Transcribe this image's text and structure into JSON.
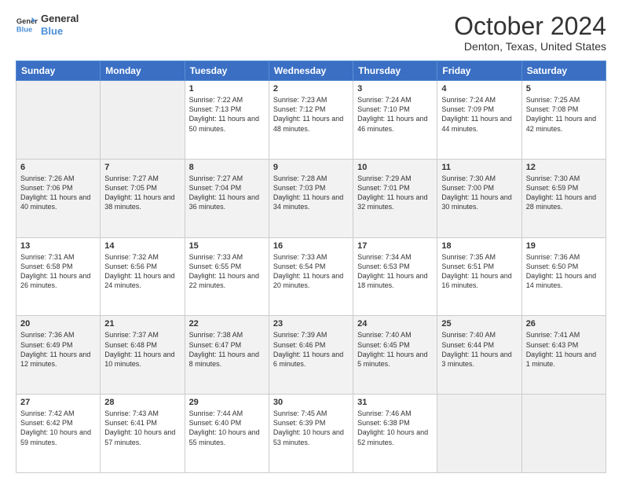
{
  "logo": {
    "line1": "General",
    "line2": "Blue"
  },
  "title": "October 2024",
  "location": "Denton, Texas, United States",
  "days_of_week": [
    "Sunday",
    "Monday",
    "Tuesday",
    "Wednesday",
    "Thursday",
    "Friday",
    "Saturday"
  ],
  "weeks": [
    [
      {
        "day": "",
        "sunrise": "",
        "sunset": "",
        "daylight": "",
        "empty": true
      },
      {
        "day": "",
        "sunrise": "",
        "sunset": "",
        "daylight": "",
        "empty": true
      },
      {
        "day": "1",
        "sunrise": "Sunrise: 7:22 AM",
        "sunset": "Sunset: 7:13 PM",
        "daylight": "Daylight: 11 hours and 50 minutes."
      },
      {
        "day": "2",
        "sunrise": "Sunrise: 7:23 AM",
        "sunset": "Sunset: 7:12 PM",
        "daylight": "Daylight: 11 hours and 48 minutes."
      },
      {
        "day": "3",
        "sunrise": "Sunrise: 7:24 AM",
        "sunset": "Sunset: 7:10 PM",
        "daylight": "Daylight: 11 hours and 46 minutes."
      },
      {
        "day": "4",
        "sunrise": "Sunrise: 7:24 AM",
        "sunset": "Sunset: 7:09 PM",
        "daylight": "Daylight: 11 hours and 44 minutes."
      },
      {
        "day": "5",
        "sunrise": "Sunrise: 7:25 AM",
        "sunset": "Sunset: 7:08 PM",
        "daylight": "Daylight: 11 hours and 42 minutes."
      }
    ],
    [
      {
        "day": "6",
        "sunrise": "Sunrise: 7:26 AM",
        "sunset": "Sunset: 7:06 PM",
        "daylight": "Daylight: 11 hours and 40 minutes."
      },
      {
        "day": "7",
        "sunrise": "Sunrise: 7:27 AM",
        "sunset": "Sunset: 7:05 PM",
        "daylight": "Daylight: 11 hours and 38 minutes."
      },
      {
        "day": "8",
        "sunrise": "Sunrise: 7:27 AM",
        "sunset": "Sunset: 7:04 PM",
        "daylight": "Daylight: 11 hours and 36 minutes."
      },
      {
        "day": "9",
        "sunrise": "Sunrise: 7:28 AM",
        "sunset": "Sunset: 7:03 PM",
        "daylight": "Daylight: 11 hours and 34 minutes."
      },
      {
        "day": "10",
        "sunrise": "Sunrise: 7:29 AM",
        "sunset": "Sunset: 7:01 PM",
        "daylight": "Daylight: 11 hours and 32 minutes."
      },
      {
        "day": "11",
        "sunrise": "Sunrise: 7:30 AM",
        "sunset": "Sunset: 7:00 PM",
        "daylight": "Daylight: 11 hours and 30 minutes."
      },
      {
        "day": "12",
        "sunrise": "Sunrise: 7:30 AM",
        "sunset": "Sunset: 6:59 PM",
        "daylight": "Daylight: 11 hours and 28 minutes."
      }
    ],
    [
      {
        "day": "13",
        "sunrise": "Sunrise: 7:31 AM",
        "sunset": "Sunset: 6:58 PM",
        "daylight": "Daylight: 11 hours and 26 minutes."
      },
      {
        "day": "14",
        "sunrise": "Sunrise: 7:32 AM",
        "sunset": "Sunset: 6:56 PM",
        "daylight": "Daylight: 11 hours and 24 minutes."
      },
      {
        "day": "15",
        "sunrise": "Sunrise: 7:33 AM",
        "sunset": "Sunset: 6:55 PM",
        "daylight": "Daylight: 11 hours and 22 minutes."
      },
      {
        "day": "16",
        "sunrise": "Sunrise: 7:33 AM",
        "sunset": "Sunset: 6:54 PM",
        "daylight": "Daylight: 11 hours and 20 minutes."
      },
      {
        "day": "17",
        "sunrise": "Sunrise: 7:34 AM",
        "sunset": "Sunset: 6:53 PM",
        "daylight": "Daylight: 11 hours and 18 minutes."
      },
      {
        "day": "18",
        "sunrise": "Sunrise: 7:35 AM",
        "sunset": "Sunset: 6:51 PM",
        "daylight": "Daylight: 11 hours and 16 minutes."
      },
      {
        "day": "19",
        "sunrise": "Sunrise: 7:36 AM",
        "sunset": "Sunset: 6:50 PM",
        "daylight": "Daylight: 11 hours and 14 minutes."
      }
    ],
    [
      {
        "day": "20",
        "sunrise": "Sunrise: 7:36 AM",
        "sunset": "Sunset: 6:49 PM",
        "daylight": "Daylight: 11 hours and 12 minutes."
      },
      {
        "day": "21",
        "sunrise": "Sunrise: 7:37 AM",
        "sunset": "Sunset: 6:48 PM",
        "daylight": "Daylight: 11 hours and 10 minutes."
      },
      {
        "day": "22",
        "sunrise": "Sunrise: 7:38 AM",
        "sunset": "Sunset: 6:47 PM",
        "daylight": "Daylight: 11 hours and 8 minutes."
      },
      {
        "day": "23",
        "sunrise": "Sunrise: 7:39 AM",
        "sunset": "Sunset: 6:46 PM",
        "daylight": "Daylight: 11 hours and 6 minutes."
      },
      {
        "day": "24",
        "sunrise": "Sunrise: 7:40 AM",
        "sunset": "Sunset: 6:45 PM",
        "daylight": "Daylight: 11 hours and 5 minutes."
      },
      {
        "day": "25",
        "sunrise": "Sunrise: 7:40 AM",
        "sunset": "Sunset: 6:44 PM",
        "daylight": "Daylight: 11 hours and 3 minutes."
      },
      {
        "day": "26",
        "sunrise": "Sunrise: 7:41 AM",
        "sunset": "Sunset: 6:43 PM",
        "daylight": "Daylight: 11 hours and 1 minute."
      }
    ],
    [
      {
        "day": "27",
        "sunrise": "Sunrise: 7:42 AM",
        "sunset": "Sunset: 6:42 PM",
        "daylight": "Daylight: 10 hours and 59 minutes."
      },
      {
        "day": "28",
        "sunrise": "Sunrise: 7:43 AM",
        "sunset": "Sunset: 6:41 PM",
        "daylight": "Daylight: 10 hours and 57 minutes."
      },
      {
        "day": "29",
        "sunrise": "Sunrise: 7:44 AM",
        "sunset": "Sunset: 6:40 PM",
        "daylight": "Daylight: 10 hours and 55 minutes."
      },
      {
        "day": "30",
        "sunrise": "Sunrise: 7:45 AM",
        "sunset": "Sunset: 6:39 PM",
        "daylight": "Daylight: 10 hours and 53 minutes."
      },
      {
        "day": "31",
        "sunrise": "Sunrise: 7:46 AM",
        "sunset": "Sunset: 6:38 PM",
        "daylight": "Daylight: 10 hours and 52 minutes."
      },
      {
        "day": "",
        "sunrise": "",
        "sunset": "",
        "daylight": "",
        "empty": true
      },
      {
        "day": "",
        "sunrise": "",
        "sunset": "",
        "daylight": "",
        "empty": true
      }
    ]
  ]
}
